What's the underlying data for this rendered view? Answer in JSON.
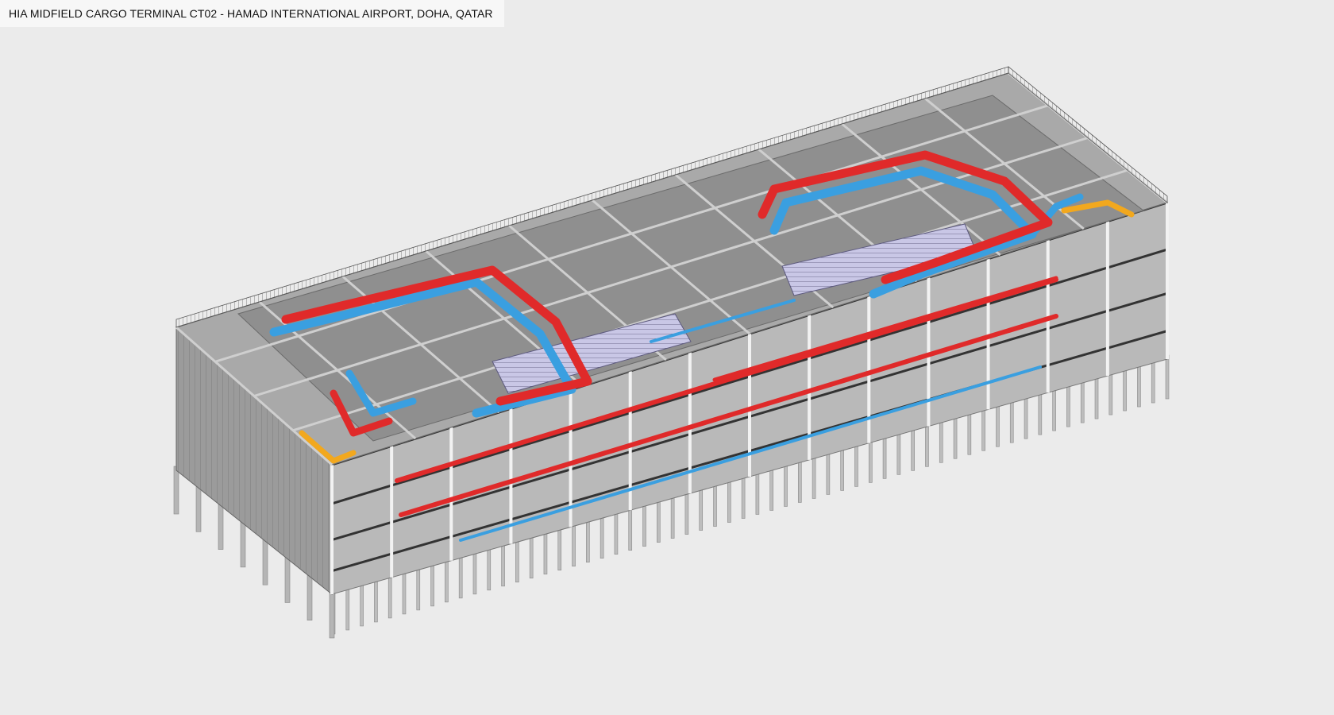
{
  "title": "HIA MIDFIELD CARGO TERMINAL CT02 - HAMAD INTERNATIONAL AIRPORT, DOHA, QATAR",
  "colors": {
    "background": "#ebebeb",
    "supply_duct": "#e02a2a",
    "return_duct": "#3a9fe0",
    "exhaust_duct": "#f2a81e",
    "storage_racks": "#c9c7e6",
    "concrete": "#9a9a9a"
  }
}
